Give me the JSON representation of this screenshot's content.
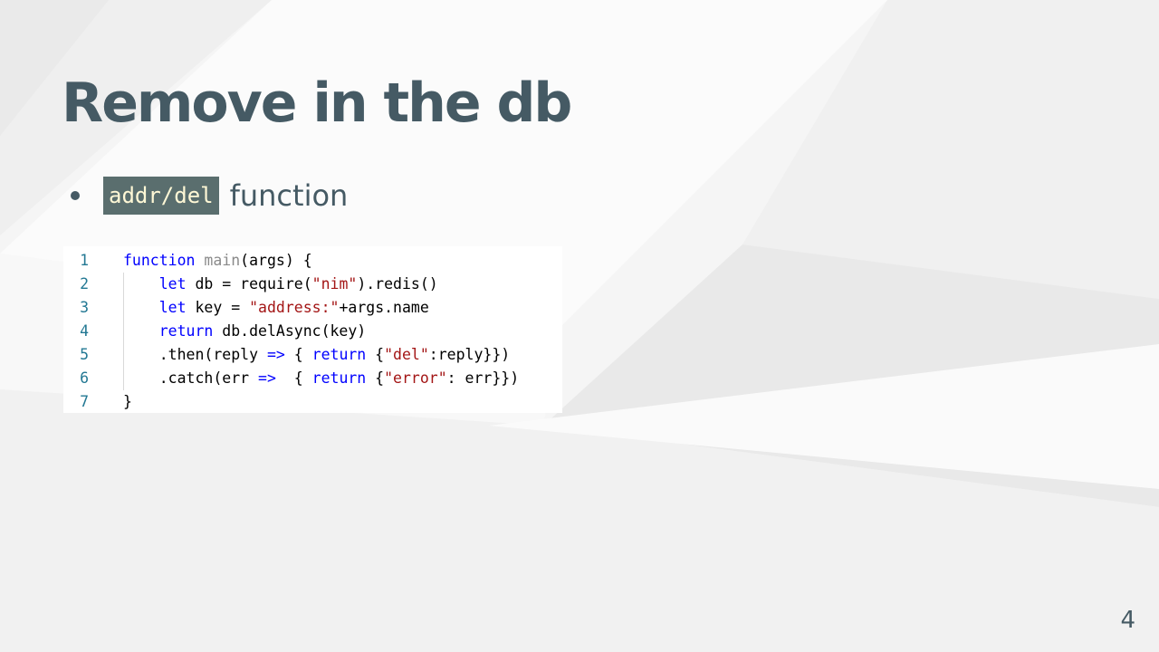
{
  "slide": {
    "title": "Remove in the db",
    "page_number": "4"
  },
  "bullets": [
    {
      "code": "addr/del",
      "text": "function"
    }
  ],
  "code": {
    "lines": [
      {
        "number": "1",
        "tokens": [
          {
            "t": "function",
            "kind": "kw"
          },
          {
            "t": " ",
            "kind": "plain"
          },
          {
            "t": "main",
            "kind": "fn-name"
          },
          {
            "t": "(args) {",
            "kind": "plain"
          }
        ]
      },
      {
        "number": "2",
        "tokens": [
          {
            "t": "    ",
            "kind": "plain"
          },
          {
            "t": "let",
            "kind": "kw"
          },
          {
            "t": " db = require(",
            "kind": "plain"
          },
          {
            "t": "\"nim\"",
            "kind": "str"
          },
          {
            "t": ").redis()",
            "kind": "plain"
          }
        ]
      },
      {
        "number": "3",
        "tokens": [
          {
            "t": "    ",
            "kind": "plain"
          },
          {
            "t": "let",
            "kind": "kw"
          },
          {
            "t": " key = ",
            "kind": "plain"
          },
          {
            "t": "\"address:\"",
            "kind": "str"
          },
          {
            "t": "+args.name",
            "kind": "plain"
          }
        ]
      },
      {
        "number": "4",
        "tokens": [
          {
            "t": "    ",
            "kind": "plain"
          },
          {
            "t": "return",
            "kind": "kw"
          },
          {
            "t": " db.delAsync(key)",
            "kind": "plain"
          }
        ]
      },
      {
        "number": "5",
        "tokens": [
          {
            "t": "    .then(reply ",
            "kind": "plain"
          },
          {
            "t": "=>",
            "kind": "op"
          },
          {
            "t": " { ",
            "kind": "plain"
          },
          {
            "t": "return",
            "kind": "kw"
          },
          {
            "t": " {",
            "kind": "plain"
          },
          {
            "t": "\"del\"",
            "kind": "str"
          },
          {
            "t": ":reply}})",
            "kind": "plain"
          }
        ]
      },
      {
        "number": "6",
        "tokens": [
          {
            "t": "    .catch(err ",
            "kind": "plain"
          },
          {
            "t": "=>",
            "kind": "op"
          },
          {
            "t": "  { ",
            "kind": "plain"
          },
          {
            "t": "return",
            "kind": "kw"
          },
          {
            "t": " {",
            "kind": "plain"
          },
          {
            "t": "\"error\"",
            "kind": "str"
          },
          {
            "t": ": err}})",
            "kind": "plain"
          }
        ]
      },
      {
        "number": "7",
        "tokens": [
          {
            "t": "}",
            "kind": "plain"
          }
        ]
      }
    ]
  },
  "colors": {
    "title": "#455a64",
    "inline_code_bg": "#5a6e6e",
    "inline_code_fg": "#fff8d6",
    "keyword": "#0000ff",
    "string": "#a31515",
    "line_number": "#237893"
  }
}
